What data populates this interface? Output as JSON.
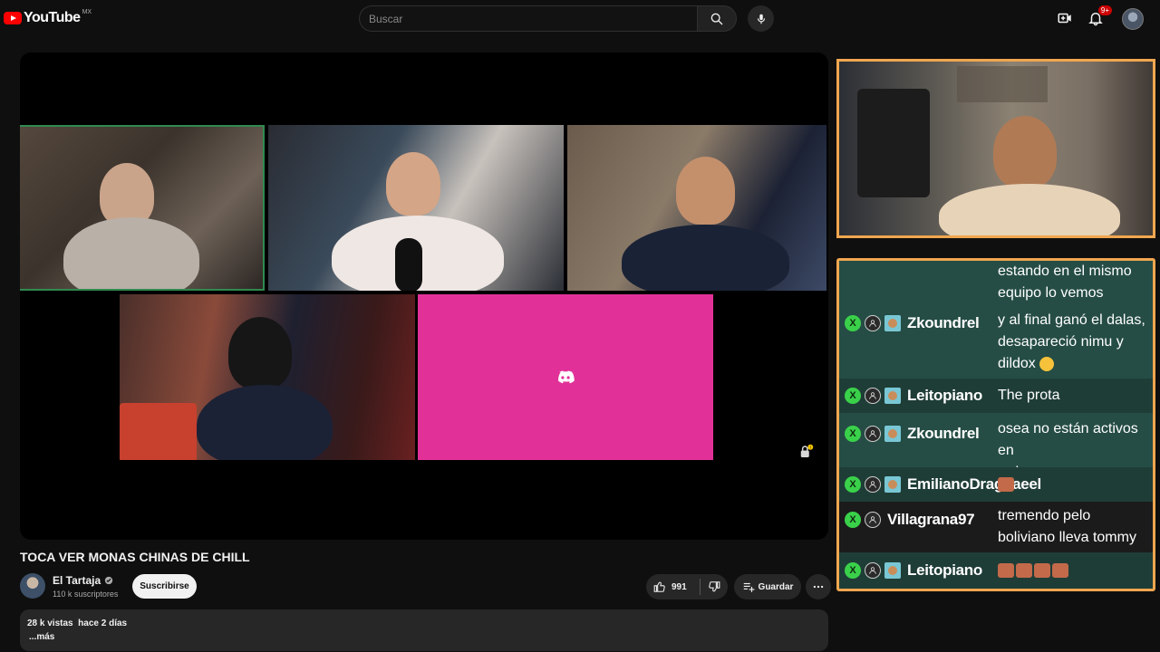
{
  "header": {
    "logo_text": "YouTube",
    "country_code": "MX",
    "search_placeholder": "Buscar",
    "notification_badge": "9+"
  },
  "video": {
    "title": "TOCA VER MONAS CHINAS DE CHILL",
    "channel": {
      "name": "El Tartaja",
      "subscribers": "110 k suscriptores"
    },
    "subscribe_label": "Suscribirse",
    "like_count": "991",
    "save_label": "Guardar",
    "views": "28 k vistas",
    "posted": "hace 2 días",
    "more_label": "...más",
    "lock_badge": "!"
  },
  "colors": {
    "discord_pink": "#e13198",
    "overlay_border": "#f0a64f",
    "chat_bg": "#254d45",
    "badge_green": "#3ad14a"
  },
  "chat": {
    "messages": [
      {
        "user": "",
        "lines": [
          "estando en el mismo",
          "equipo lo vemos"
        ]
      },
      {
        "user": "Zkoundrel",
        "lines": [
          "y al final ganó el dalas,",
          "desapareció nimu y",
          "dildox"
        ]
      },
      {
        "user": "Leitopiano",
        "lines": [
          "The prota"
        ]
      },
      {
        "user": "Zkoundrel",
        "lines": [
          "osea no están activos en",
          "redes"
        ]
      },
      {
        "user": "EmilianoDragnaeel",
        "lines": [
          ""
        ]
      },
      {
        "user": "Villagrana97",
        "lines": [
          "tremendo pelo",
          "boliviano lleva tommy"
        ]
      },
      {
        "user": "Leitopiano",
        "lines": [
          ""
        ]
      }
    ]
  }
}
